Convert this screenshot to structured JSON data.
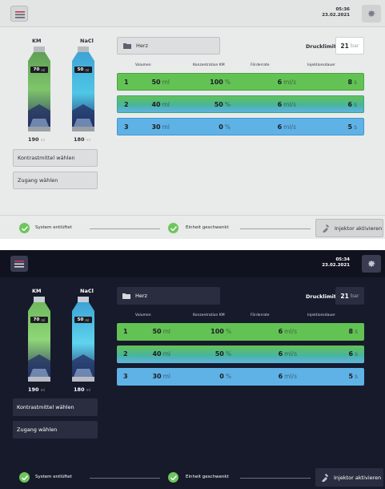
{
  "header": {
    "time": "05:36",
    "date": "23.02.2021"
  },
  "bottles": [
    {
      "label": "KM",
      "fill_volume": "70",
      "fill_unit": "ml",
      "total": "190",
      "total_unit": "ml"
    },
    {
      "label": "NaCl",
      "fill_volume": "50",
      "fill_unit": "ml",
      "total": "180",
      "total_unit": "ml"
    }
  ],
  "side_buttons": {
    "contrast": "Kontrastmittel wählen",
    "access": "Zugang wählen"
  },
  "region": {
    "name": "Herz"
  },
  "pressure": {
    "label": "Drucklimit",
    "value": "21",
    "unit": "bar"
  },
  "table": {
    "headers": {
      "volume": "Volumen",
      "concentration": "Konzentration KM",
      "rate": "Förderrate",
      "duration": "Injektionsdauer"
    },
    "phases": [
      {
        "num": "1",
        "volume": "50",
        "volume_unit": "ml",
        "conc": "100",
        "conc_unit": "%",
        "rate": "6",
        "rate_unit": "ml/s",
        "dur": "8",
        "dur_unit": "s"
      },
      {
        "num": "2",
        "volume": "40",
        "volume_unit": "ml",
        "conc": "50",
        "conc_unit": "%",
        "rate": "6",
        "rate_unit": "ml/s",
        "dur": "6",
        "dur_unit": "s"
      },
      {
        "num": "3",
        "volume": "30",
        "volume_unit": "ml",
        "conc": "0",
        "conc_unit": "%",
        "rate": "6",
        "rate_unit": "ml/s",
        "dur": "5",
        "dur_unit": "s"
      }
    ]
  },
  "status": {
    "vented": "System entlüftet",
    "swiveled": "Einheit geschwenkt"
  },
  "inject_button": "Injektor aktivieren",
  "dark": {
    "time": "05:34",
    "date": "23.02.2021"
  },
  "colors": {
    "green": "#63c254",
    "blue": "#5fb2e6",
    "split": "#49b59c",
    "check": "#6fc55d"
  }
}
